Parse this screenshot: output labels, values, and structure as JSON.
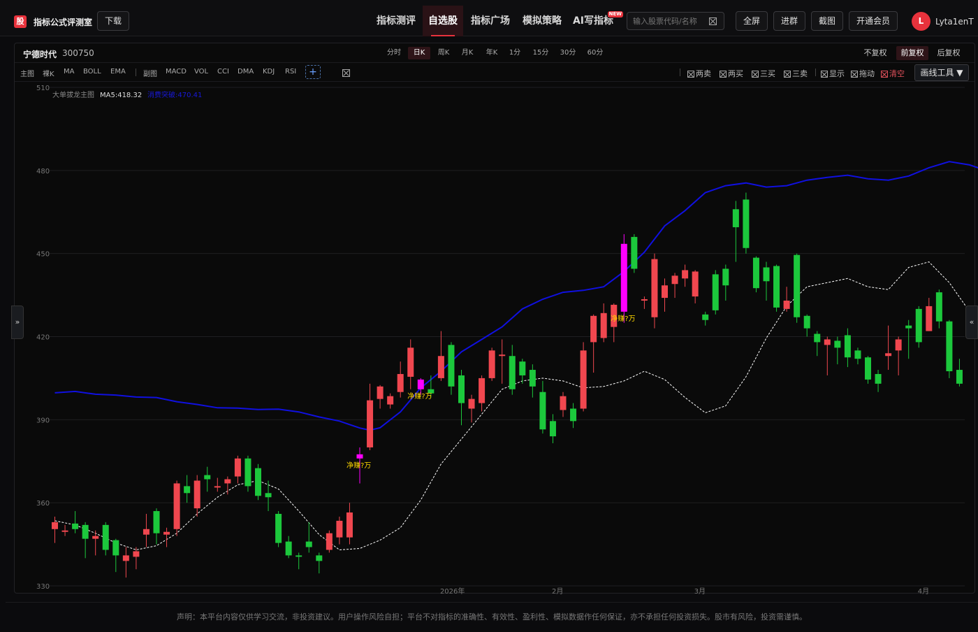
{
  "header": {
    "logo_char": "股",
    "brand": "指标公式评测室",
    "download_label": "下载",
    "nav": [
      {
        "label": "指标测评",
        "active": false
      },
      {
        "label": "自选股",
        "active": true
      },
      {
        "label": "指标广场",
        "active": false
      },
      {
        "label": "模拟策略",
        "active": false
      },
      {
        "label": "AI写指标",
        "active": false,
        "badge": "NEW"
      }
    ],
    "search_placeholder": "输入股票代码/名称",
    "buttons": [
      "全屏",
      "进群",
      "截图",
      "开通会员"
    ],
    "avatar_initial": "L",
    "username": "Lyta1enT"
  },
  "stock": {
    "name": "宁德时代",
    "code": "300750"
  },
  "periods": [
    {
      "label": "分时",
      "active": false
    },
    {
      "label": "日K",
      "active": true
    },
    {
      "label": "周K",
      "active": false
    },
    {
      "label": "月K",
      "active": false
    },
    {
      "label": "年K",
      "active": false
    },
    {
      "label": "1分",
      "active": false
    },
    {
      "label": "15分",
      "active": false
    },
    {
      "label": "30分",
      "active": false
    },
    {
      "label": "60分",
      "active": false
    }
  ],
  "adjust": [
    {
      "label": "不复权",
      "active": false
    },
    {
      "label": "前复权",
      "active": true
    },
    {
      "label": "后复权",
      "active": false
    }
  ],
  "tools": {
    "main": [
      "主图",
      "裸K",
      "MA",
      "BOLL",
      "EMA"
    ],
    "sub": [
      "副图",
      "MACD",
      "VOL",
      "CCI",
      "DMA",
      "KDJ",
      "RSI"
    ],
    "add": "+",
    "right": [
      {
        "label": "两卖",
        "red": false
      },
      {
        "label": "两买",
        "red": false
      },
      {
        "label": "三买",
        "red": false
      },
      {
        "label": "三卖",
        "red": false
      },
      {
        "label": "显示",
        "red": false
      },
      {
        "label": "拖动",
        "red": false
      },
      {
        "label": "清空",
        "red": true
      }
    ],
    "draw_tools": "画线工具 ▼"
  },
  "side": {
    "left": "»",
    "right": "«"
  },
  "footer": "声明：本平台内容仅供学习交流，非投资建议。用户操作风险自担；平台不对指标的准确性、有效性、盈利性、模拟数据作任何保证，亦不承担任何投资损失。股市有风险，投资需谨慎。",
  "chart_data": {
    "type": "candlestick",
    "legend": {
      "indicator": "大单拔龙主图",
      "ma5": "MA5:418.32",
      "blue_line": "消费突破:470.41"
    },
    "colors": {
      "up": "#f0474f",
      "down": "#1cc83c",
      "highlight": "#ff00ff",
      "ma5": "#ffffff",
      "blue_line": "#1010e0",
      "marker": "#ffd700"
    },
    "ylim": [
      330,
      510
    ],
    "yticks": [
      330,
      360,
      390,
      420,
      450,
      480,
      510
    ],
    "xlabels": [
      {
        "i": 39,
        "label": "2026年"
      },
      {
        "i": 50,
        "label": "2月"
      },
      {
        "i": 64,
        "label": "3月"
      },
      {
        "i": 86,
        "label": "4月"
      }
    ],
    "candles": [
      [
        350.5,
        353.0,
        355.0,
        345.5
      ],
      [
        349.5,
        350.0,
        352.0,
        348.0
      ],
      [
        352.5,
        350.5,
        357.0,
        349.0
      ],
      [
        352.0,
        347.0,
        353.0,
        340.0
      ],
      [
        347.0,
        348.0,
        350.0,
        341.0
      ],
      [
        352.0,
        343.0,
        353.0,
        341.0
      ],
      [
        346.5,
        341.0,
        347.0,
        335.0
      ],
      [
        339.0,
        341.0,
        344.0,
        333.0
      ],
      [
        340.5,
        342.5,
        344.0,
        336.0
      ],
      [
        348.5,
        350.5,
        356.0,
        344.0
      ],
      [
        357.0,
        349.0,
        358.0,
        345.0
      ],
      [
        348.5,
        349.5,
        351.0,
        344.0
      ],
      [
        350.5,
        367.0,
        368.0,
        348.0
      ],
      [
        366.0,
        363.5,
        370.0,
        360.0
      ],
      [
        358.0,
        368.0,
        370.0,
        355.0
      ],
      [
        370.0,
        368.5,
        373.0,
        364.0
      ],
      [
        365.5,
        366.0,
        369.0,
        364.0
      ],
      [
        367.0,
        368.5,
        369.5,
        363.0
      ],
      [
        369.5,
        376.0,
        377.0,
        367.0
      ],
      [
        376.0,
        366.0,
        377.0,
        364.0
      ],
      [
        372.5,
        362.5,
        374.0,
        361.0
      ],
      [
        363.5,
        362.0,
        368.0,
        357.0
      ],
      [
        356.0,
        345.5,
        357.0,
        344.0
      ],
      [
        346.0,
        341.0,
        348.0,
        340.0
      ],
      [
        341.0,
        340.5,
        342.0,
        336.0
      ],
      [
        346.0,
        344.0,
        353.0,
        342.0
      ],
      [
        341.0,
        339.0,
        342.0,
        334.5
      ],
      [
        343.0,
        349.0,
        350.0,
        342.0
      ],
      [
        347.5,
        353.5,
        355.0,
        345.0
      ],
      [
        347.5,
        356.5,
        360.0,
        345.0
      ],
      [
        376.0,
        377.5,
        380.0,
        367.0
      ],
      [
        380.0,
        397.0,
        403.0,
        379.0
      ],
      [
        397.5,
        402.0,
        402.5,
        394.0
      ],
      [
        395.5,
        398.5,
        399.5,
        394.0
      ],
      [
        400.0,
        406.5,
        411.0,
        398.0
      ],
      [
        405.5,
        416.0,
        419.0,
        401.0
      ],
      [
        404.5,
        401.0,
        405.0,
        399.0
      ],
      [
        401.0,
        399.5,
        406.0,
        398.0
      ],
      [
        405.0,
        413.0,
        422.0,
        404.0
      ],
      [
        417.0,
        402.0,
        418.0,
        399.0
      ],
      [
        406.0,
        396.0,
        408.0,
        388.0
      ],
      [
        394.0,
        397.5,
        399.0,
        389.0
      ],
      [
        396.0,
        405.0,
        406.0,
        393.0
      ],
      [
        405.0,
        415.0,
        416.0,
        404.0
      ],
      [
        413.0,
        413.5,
        419.0,
        403.0
      ],
      [
        413.0,
        401.0,
        417.0,
        399.0
      ],
      [
        411.0,
        406.0,
        412.0,
        403.0
      ],
      [
        408.0,
        402.0,
        410.0,
        398.0
      ],
      [
        400.0,
        386.5,
        404.0,
        385.0
      ],
      [
        389.5,
        384.0,
        392.0,
        381.5
      ],
      [
        393.5,
        398.5,
        400.0,
        391.0
      ],
      [
        394.0,
        389.5,
        396.0,
        387.0
      ],
      [
        394.0,
        415.0,
        418.0,
        393.0
      ],
      [
        418.0,
        427.5,
        428.0,
        407.0
      ],
      [
        419.5,
        428.5,
        432.0,
        418.0
      ],
      [
        423.5,
        431.5,
        432.0,
        418.0
      ],
      [
        429.0,
        453.5,
        457.0,
        425.0
      ],
      [
        456.0,
        444.5,
        457.0,
        443.0
      ],
      [
        433.0,
        433.5,
        434.5,
        430.0
      ],
      [
        427.0,
        448.0,
        450.0,
        423.0
      ],
      [
        434.0,
        438.5,
        441.0,
        429.0
      ],
      [
        439.0,
        442.0,
        443.0,
        434.0
      ],
      [
        441.0,
        444.0,
        446.0,
        438.0
      ],
      [
        434.5,
        443.5,
        444.0,
        432.0
      ],
      [
        428.0,
        426.0,
        429.0,
        424.0
      ],
      [
        442.5,
        429.5,
        444.0,
        428.0
      ],
      [
        444.5,
        438.5,
        446.0,
        433.0
      ],
      [
        466.0,
        459.5,
        469.0,
        447.0
      ],
      [
        469.5,
        452.0,
        472.0,
        450.0
      ],
      [
        448.5,
        437.5,
        449.0,
        436.0
      ],
      [
        445.0,
        440.0,
        447.0,
        433.0
      ],
      [
        445.5,
        430.5,
        446.0,
        429.0
      ],
      [
        430.0,
        433.0,
        438.0,
        429.0
      ],
      [
        449.5,
        427.0,
        450.0,
        425.0
      ],
      [
        427.5,
        423.0,
        428.0,
        420.0
      ],
      [
        421.0,
        418.0,
        422.0,
        413.0
      ],
      [
        417.0,
        419.0,
        420.0,
        406.0
      ],
      [
        418.5,
        416.0,
        420.0,
        410.0
      ],
      [
        420.5,
        412.5,
        423.0,
        409.0
      ],
      [
        415.0,
        412.0,
        416.0,
        410.0
      ],
      [
        412.5,
        404.5,
        413.0,
        403.0
      ],
      [
        406.5,
        403.0,
        408.0,
        400.0
      ],
      [
        413.0,
        414.0,
        424.0,
        408.0
      ],
      [
        415.0,
        419.0,
        420.0,
        406.0
      ],
      [
        424.0,
        423.0,
        426.0,
        412.0
      ],
      [
        430.0,
        418.0,
        431.0,
        416.0
      ],
      [
        422.0,
        431.0,
        434.0,
        422.0
      ],
      [
        436.0,
        425.5,
        437.0,
        423.0
      ],
      [
        425.5,
        407.5,
        426.0,
        405.0
      ],
      [
        408.0,
        403.0,
        412.0,
        402.0
      ]
    ],
    "highlight_candles": [
      30,
      36,
      56
    ],
    "markers": [
      {
        "i": 30,
        "label": "净赚?万"
      },
      {
        "i": 36,
        "label": "净赚?万"
      },
      {
        "i": 56,
        "label": "净赚?万"
      }
    ],
    "blue_line": [
      [
        0,
        399.7
      ],
      [
        2,
        400.2
      ],
      [
        4,
        399.2
      ],
      [
        6,
        398.9
      ],
      [
        8,
        398.2
      ],
      [
        10,
        398.0
      ],
      [
        12,
        396.5
      ],
      [
        14,
        395.5
      ],
      [
        16,
        394.3
      ],
      [
        18,
        394.2
      ],
      [
        20,
        393.7
      ],
      [
        22,
        393.8
      ],
      [
        24,
        392.8
      ],
      [
        26,
        391.0
      ],
      [
        28,
        389.5
      ],
      [
        30,
        387.0
      ],
      [
        31,
        386.2
      ],
      [
        32,
        387.1
      ],
      [
        34,
        392.8
      ],
      [
        36,
        401.5
      ],
      [
        38,
        407.5
      ],
      [
        40,
        414.5
      ],
      [
        42,
        419.0
      ],
      [
        44,
        423.5
      ],
      [
        46,
        430.0
      ],
      [
        48,
        433.5
      ],
      [
        50,
        436.0
      ],
      [
        52,
        436.7
      ],
      [
        54,
        438.0
      ],
      [
        56,
        443.5
      ],
      [
        58,
        450.5
      ],
      [
        60,
        460.0
      ],
      [
        62,
        465.5
      ],
      [
        64,
        472.0
      ],
      [
        66,
        474.5
      ],
      [
        68,
        475.5
      ],
      [
        70,
        474.0
      ],
      [
        72,
        474.5
      ],
      [
        74,
        476.5
      ],
      [
        76,
        477.5
      ],
      [
        78,
        478.3
      ],
      [
        80,
        477.0
      ],
      [
        82,
        476.5
      ],
      [
        84,
        478.0
      ],
      [
        86,
        481.0
      ],
      [
        88,
        483.2
      ],
      [
        90,
        482.0
      ],
      [
        92,
        479.5
      ],
      [
        93,
        477.0
      ],
      [
        94,
        474.0
      ],
      [
        95,
        472.5
      ],
      [
        96,
        471.5
      ]
    ],
    "ma5": [
      [
        0,
        353.5
      ],
      [
        2,
        352.0
      ],
      [
        4,
        349.0
      ],
      [
        6,
        345.5
      ],
      [
        8,
        343.0
      ],
      [
        10,
        344.5
      ],
      [
        12,
        349.0
      ],
      [
        14,
        356.0
      ],
      [
        16,
        362.0
      ],
      [
        18,
        366.5
      ],
      [
        20,
        368.0
      ],
      [
        22,
        365.0
      ],
      [
        24,
        357.0
      ],
      [
        26,
        348.5
      ],
      [
        28,
        343.0
      ],
      [
        30,
        343.5
      ],
      [
        32,
        346.5
      ],
      [
        34,
        351.0
      ],
      [
        36,
        361.0
      ],
      [
        38,
        374.0
      ],
      [
        40,
        383.0
      ],
      [
        42,
        392.0
      ],
      [
        44,
        401.0
      ],
      [
        46,
        404.0
      ],
      [
        48,
        405.0
      ],
      [
        50,
        404.0
      ],
      [
        52,
        401.5
      ],
      [
        54,
        402.0
      ],
      [
        56,
        404.0
      ],
      [
        58,
        407.5
      ],
      [
        60,
        404.5
      ],
      [
        62,
        398.0
      ],
      [
        64,
        392.5
      ],
      [
        66,
        395.0
      ],
      [
        68,
        405.5
      ],
      [
        70,
        419.5
      ],
      [
        72,
        431.0
      ],
      [
        74,
        438.0
      ],
      [
        76,
        439.5
      ],
      [
        78,
        441.0
      ],
      [
        80,
        438.0
      ],
      [
        82,
        437.0
      ],
      [
        84,
        445.0
      ],
      [
        86,
        447.0
      ],
      [
        88,
        439.5
      ],
      [
        90,
        429.0
      ],
      [
        92,
        420.5
      ],
      [
        94,
        416.0
      ],
      [
        96,
        413.0
      ],
      [
        98,
        409.0
      ],
      [
        100,
        408.5
      ],
      [
        102,
        410.0
      ],
      [
        104,
        416.0
      ],
      [
        106,
        422.0
      ],
      [
        108,
        423.0
      ],
      [
        109,
        419.0
      ]
    ]
  }
}
